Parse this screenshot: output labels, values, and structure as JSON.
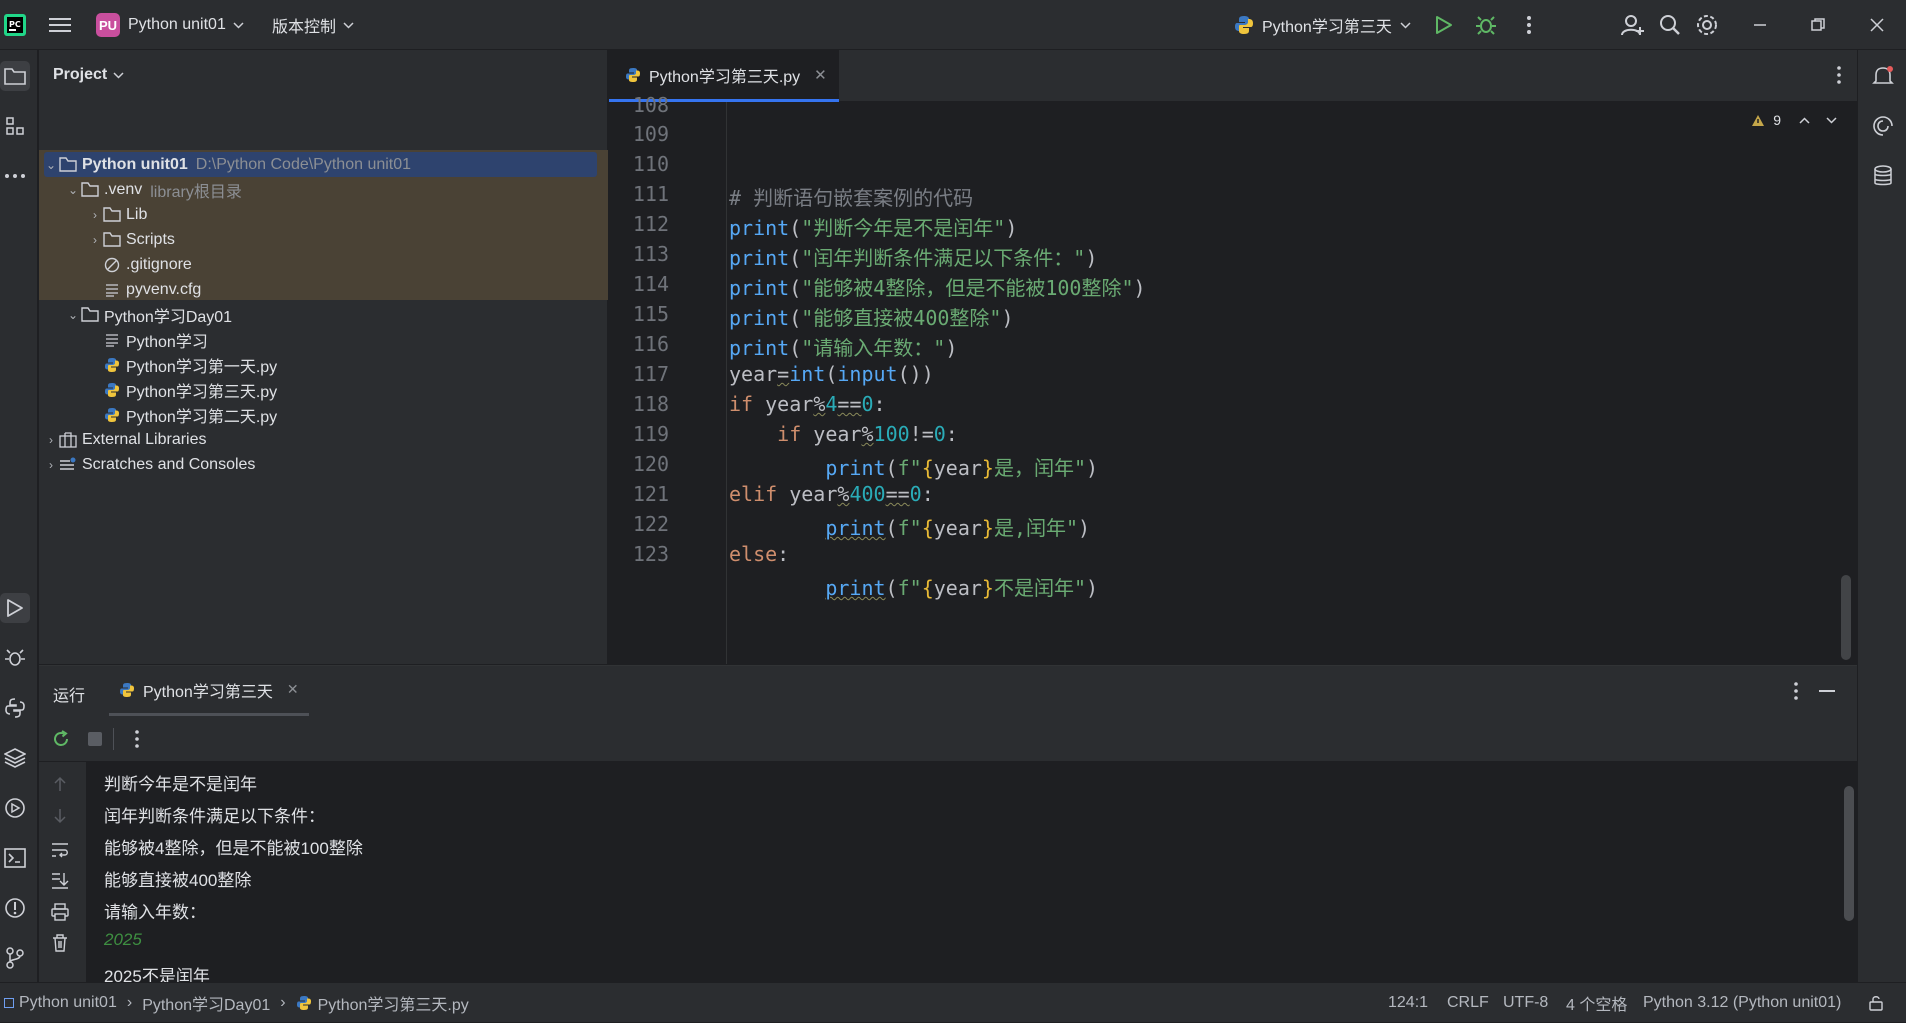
{
  "titlebar": {
    "project_badge": "PU",
    "project_name": "Python unit01",
    "vcs_label": "版本控制",
    "run_config": "Python学习第三天"
  },
  "project_panel": {
    "title": "Project",
    "tree": [
      {
        "label": "Python unit01",
        "hint": "D:\\Python Code\\Python unit01"
      },
      {
        "label": ".venv",
        "hint": "library根目录"
      },
      {
        "label": "Lib"
      },
      {
        "label": "Scripts"
      },
      {
        "label": ".gitignore"
      },
      {
        "label": "pyvenv.cfg"
      },
      {
        "label": "Python学习Day01"
      },
      {
        "label": "Python学习"
      },
      {
        "label": "Python学习第一天.py"
      },
      {
        "label": "Python学习第三天.py"
      },
      {
        "label": "Python学习第二天.py"
      },
      {
        "label": "External Libraries"
      },
      {
        "label": "Scratches and Consoles"
      }
    ]
  },
  "editor": {
    "tab_label": "Python学习第三天.py",
    "warning_count": "9",
    "line_numbers": [
      "108",
      "109",
      "110",
      "111",
      "112",
      "113",
      "114",
      "115",
      "116",
      "117",
      "118",
      "119",
      "120",
      "121",
      "122",
      "123"
    ],
    "comment_110": "# 判断语句嵌套案例的代码",
    "str_111": "\"判断今年是不是闰年\"",
    "str_112": "\"闰年判断条件满足以下条件：\"",
    "str_113": "\"能够被4整除，但是不能被100整除\"",
    "str_114": "\"能够直接被400整除\"",
    "str_115": "\"请输入年数：\"",
    "str_119": "是，闰年\"",
    "str_121": "是,闰年\"",
    "str_123": "不是闰年\""
  },
  "run_panel": {
    "label": "运行",
    "tab_label": "Python学习第三天",
    "output": [
      "判断今年是不是闰年",
      "闰年判断条件满足以下条件：",
      "能够被4整除，但是不能被100整除",
      "能够直接被400整除",
      "请输入年数："
    ],
    "user_input": "2025",
    "result": "2025不是闰年"
  },
  "statusbar": {
    "crumbs": [
      "Python unit01",
      "Python学习Day01",
      "Python学习第三天.py"
    ],
    "position": "124:1",
    "line_sep": "CRLF",
    "encoding": "UTF-8",
    "indent": "4 个空格",
    "interpreter": "Python 3.12 (Python unit01)"
  }
}
